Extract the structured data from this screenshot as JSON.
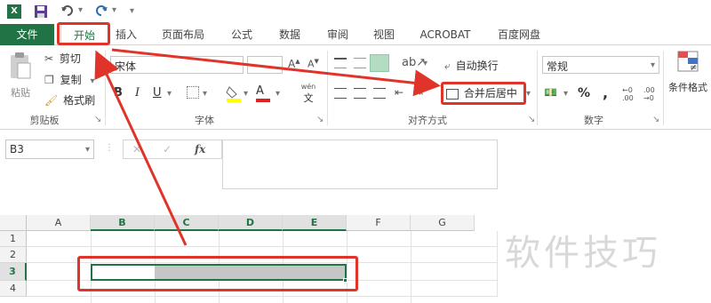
{
  "qat": {
    "excel_icon": "excel-icon",
    "save_icon": "save-icon",
    "undo_icon": "undo-icon",
    "redo_icon": "redo-icon",
    "customize": "▾"
  },
  "tabs": [
    {
      "label": "文件"
    },
    {
      "label": "开始"
    },
    {
      "label": "插入"
    },
    {
      "label": "页面布局"
    },
    {
      "label": "公式"
    },
    {
      "label": "数据"
    },
    {
      "label": "审阅"
    },
    {
      "label": "视图"
    },
    {
      "label": "ACROBAT"
    },
    {
      "label": "百度网盘"
    }
  ],
  "clipboard": {
    "paste": "粘贴",
    "cut": "剪切",
    "copy": "复制",
    "format_painter": "格式刷",
    "group": "剪贴板"
  },
  "font": {
    "name": "宋体",
    "bold": "B",
    "italic": "I",
    "underline": "U",
    "wen": "wén",
    "wen_sub": "文",
    "group": "字体",
    "color_a": "A"
  },
  "alignment": {
    "wrap_text": "自动换行",
    "merge_center": "合并后居中",
    "group": "对齐方式"
  },
  "number": {
    "format": "常规",
    "percent": "%",
    "comma": ",",
    "group": "数字"
  },
  "styles": {
    "conditional": "条件格式"
  },
  "formula": {
    "name_box": "B3",
    "fx": "fx",
    "cancel": "✕",
    "enter": "✓"
  },
  "grid": {
    "columns": [
      "A",
      "B",
      "C",
      "D",
      "E",
      "F",
      "G"
    ],
    "rows": [
      "1",
      "2",
      "3",
      "4"
    ]
  },
  "watermark": "软件技巧",
  "colors": {
    "excel_green": "#217346",
    "annotation_red": "#e0342a",
    "selection_gray": "#c6c6c6"
  }
}
